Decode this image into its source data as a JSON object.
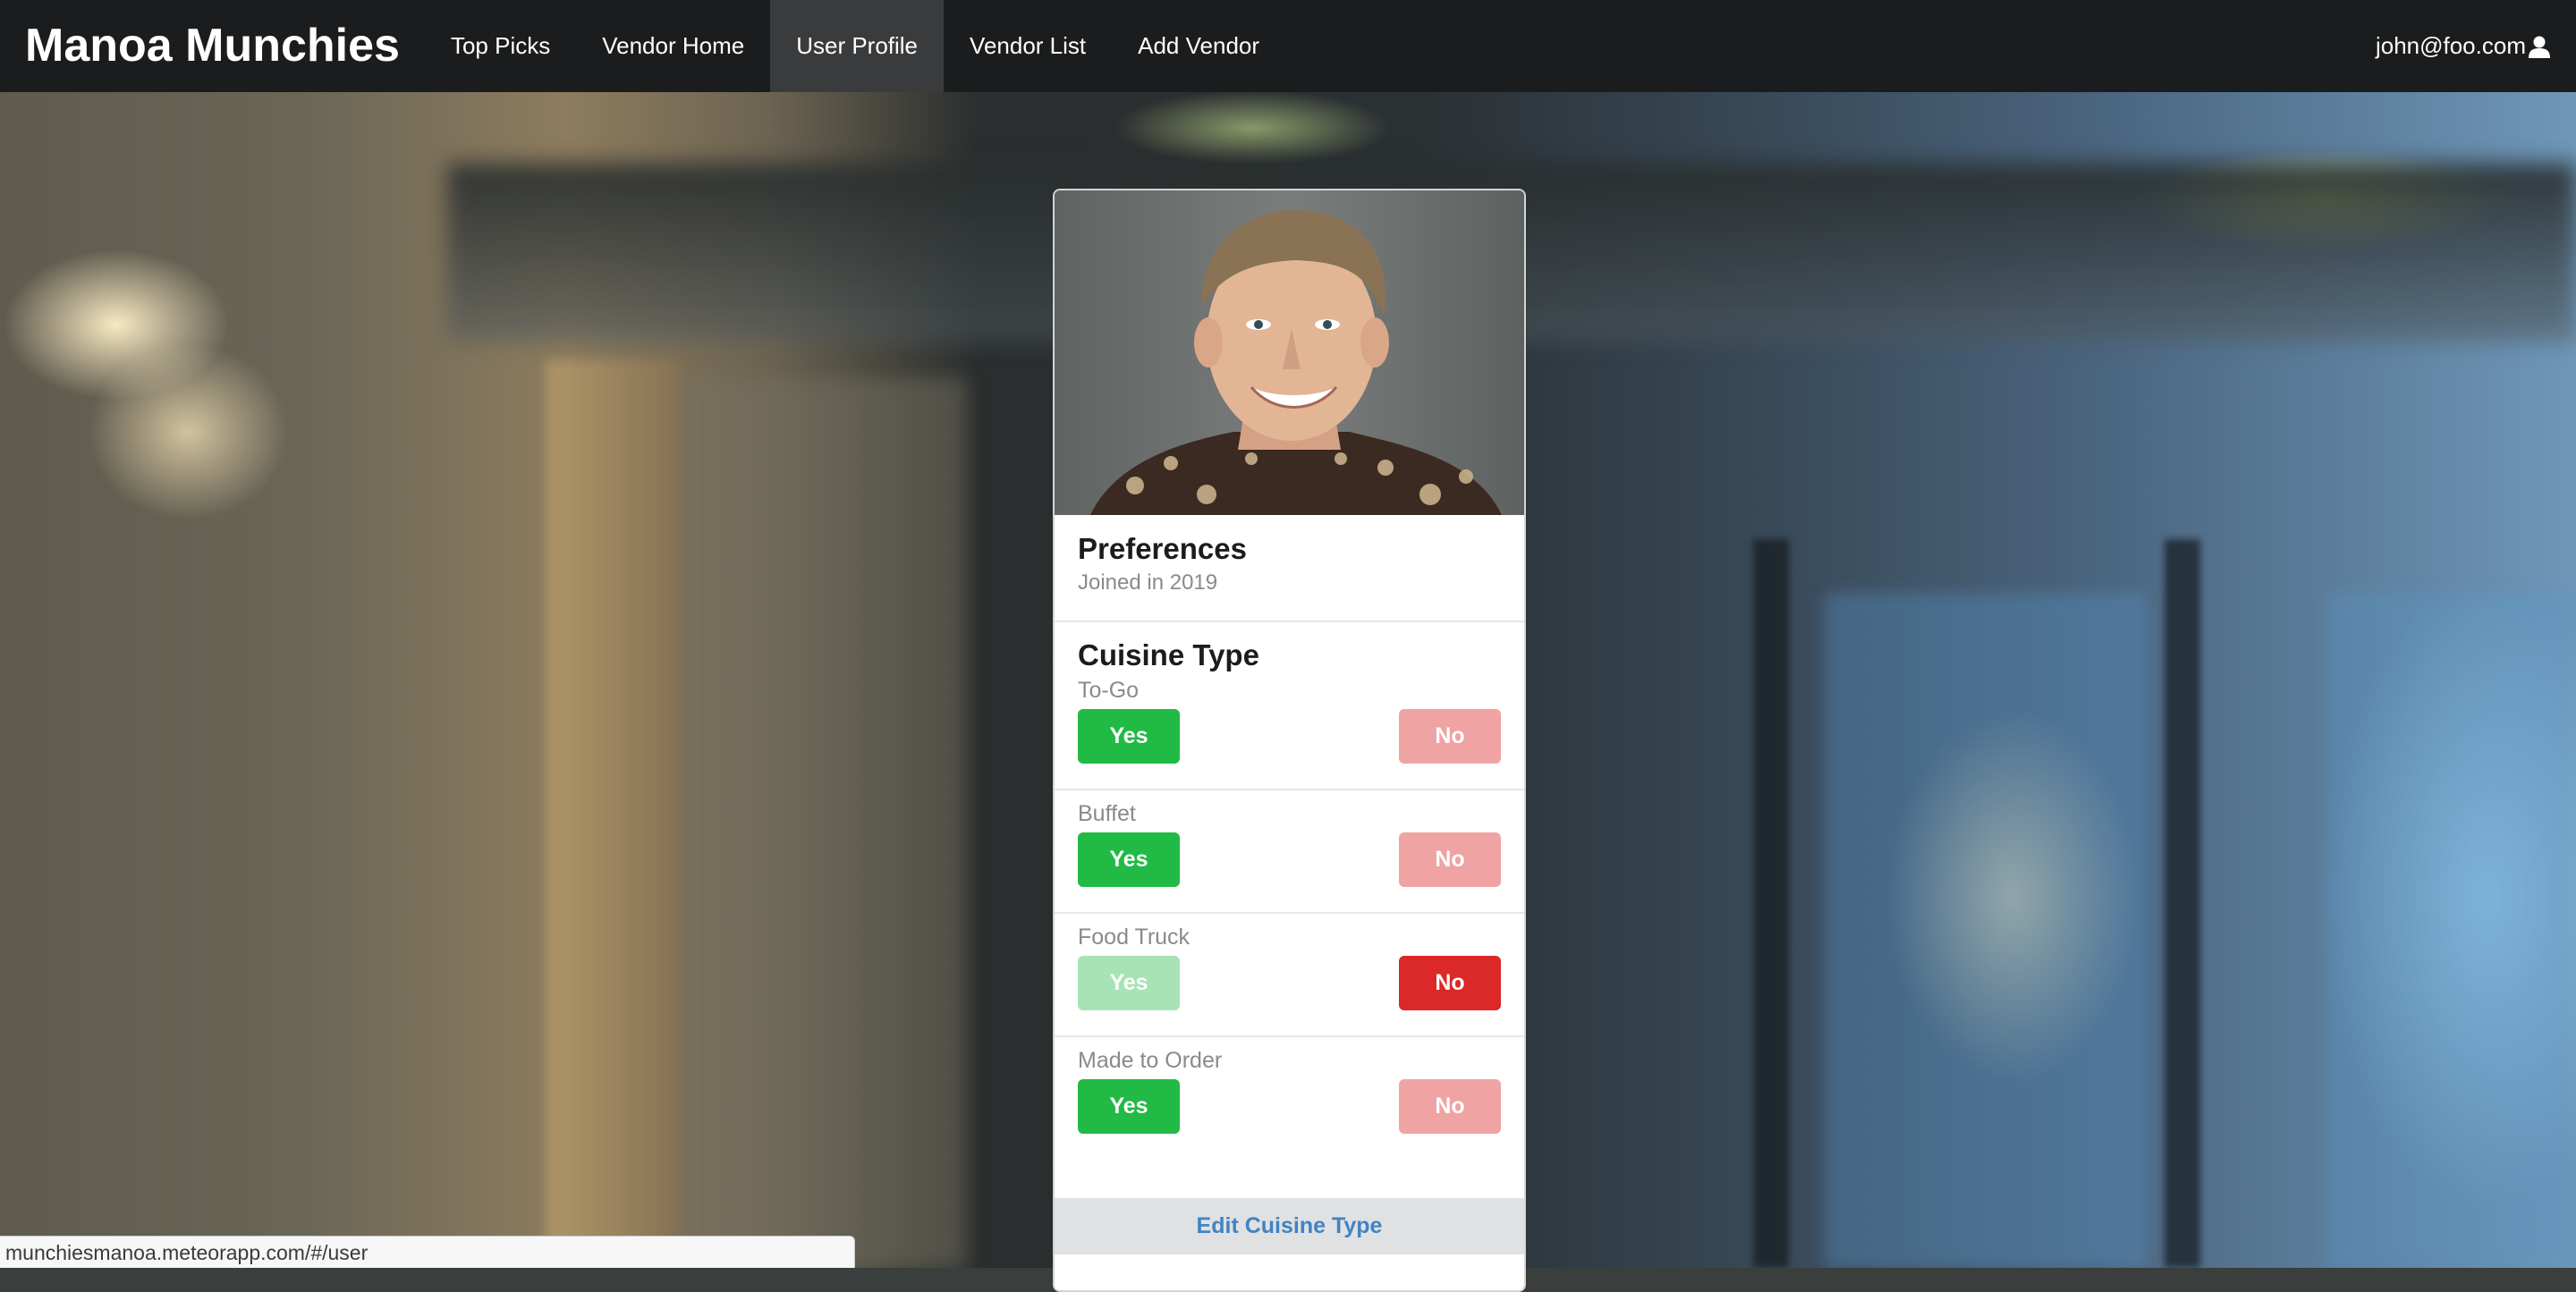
{
  "navbar": {
    "brand": "Manoa Munchies",
    "items": [
      {
        "label": "Top Picks",
        "active": false
      },
      {
        "label": "Vendor Home",
        "active": false
      },
      {
        "label": "User Profile",
        "active": true
      },
      {
        "label": "Vendor List",
        "active": false
      },
      {
        "label": "Add Vendor",
        "active": false
      }
    ],
    "user_email": "john@foo.com",
    "user_icon": "user-icon"
  },
  "card": {
    "title": "Preferences",
    "meta": "Joined in 2019",
    "cuisine_title": "Cuisine Type",
    "preferences": [
      {
        "label": "To-Go",
        "yes": "Yes",
        "no": "No",
        "selected": "yes"
      },
      {
        "label": "Buffet",
        "yes": "Yes",
        "no": "No",
        "selected": "yes"
      },
      {
        "label": "Food Truck",
        "yes": "Yes",
        "no": "No",
        "selected": "no"
      },
      {
        "label": "Made to Order",
        "yes": "Yes",
        "no": "No",
        "selected": "yes"
      }
    ],
    "edit_button": "Edit Cuisine Type"
  },
  "statusbar": {
    "url": "munchiesmanoa.meteorapp.com/#/user"
  },
  "colors": {
    "navbar_bg": "#1b1c1d",
    "yes_green": "#21ba45",
    "no_red": "#db2828",
    "link_blue": "#4183c4"
  }
}
